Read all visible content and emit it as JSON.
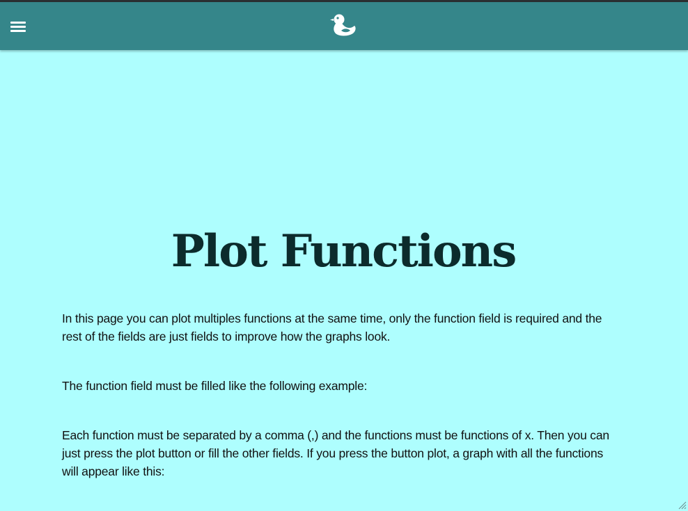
{
  "navbar": {
    "menu_icon": "hamburger-menu-icon",
    "logo_icon": "duck-logo-icon"
  },
  "main": {
    "title": "Plot Functions",
    "paragraphs": [
      "In this page you can plot multiples functions at the same time, only the function field is required and the rest of the fields are just fields to improve how the graphs look.",
      "The function field must be filled like the following example:",
      "Each function must be separated by a comma (,) and the functions must be functions of x. Then you can just press the plot button or fill the other fields. If you press the button plot, a graph with all the functions will appear like this:"
    ]
  },
  "colors": {
    "background": "#aefefe",
    "navbar": "#35868a",
    "title": "#0c2b2c"
  }
}
